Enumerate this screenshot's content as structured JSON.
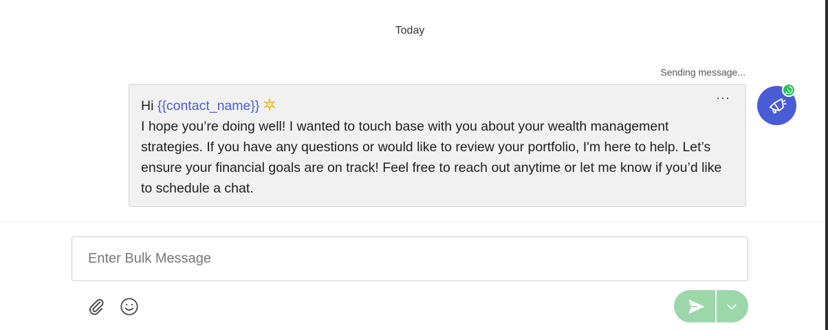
{
  "chat": {
    "date_label": "Today",
    "status": "Sending message...",
    "message": {
      "greeting": "Hi",
      "variable": "{{contact_name}}",
      "emoji": "sparkle-star",
      "body": "I hope you’re doing well! I wanted to touch base with you about your wealth management strategies. If you have any questions or would like to review your portfolio, I'm here to help. Let’s ensure your financial goals are on track! Feel free to reach out anytime or let me know if you’d like to schedule a chat.",
      "more_label": "···"
    },
    "avatar": {
      "icon": "megaphone-icon",
      "badge": "whatsapp-icon",
      "color": "#4a5bd6",
      "badge_color": "#25c35b"
    }
  },
  "composer": {
    "placeholder": "Enter Bulk Message",
    "value": "",
    "attach_icon": "paperclip-icon",
    "emoji_icon": "smiley-icon",
    "send_icon": "send-icon",
    "dropdown_icon": "chevron-down-icon",
    "send_color": "#9cd7a9"
  }
}
